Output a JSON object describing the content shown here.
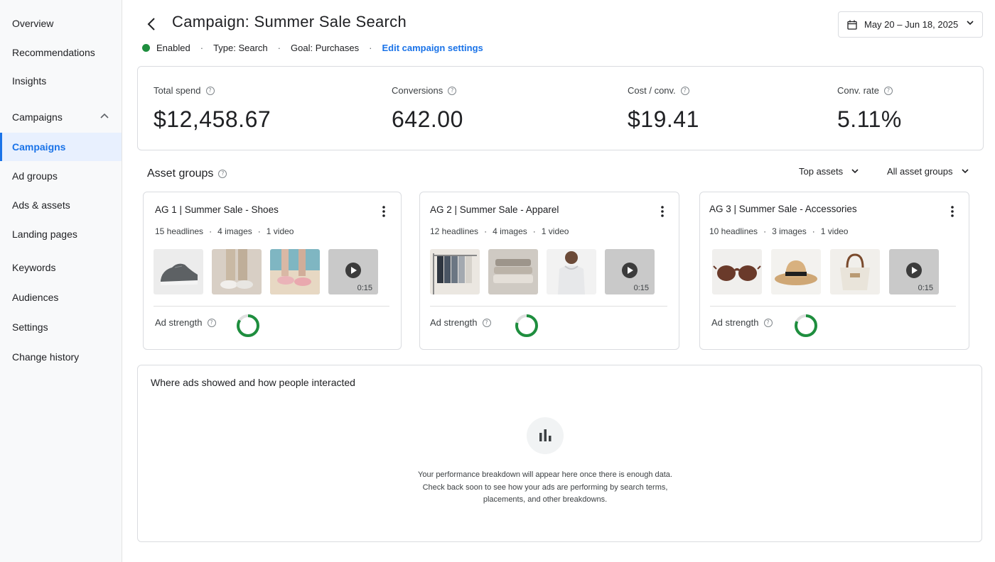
{
  "sidebar": {
    "items": [
      {
        "label": "Overview"
      },
      {
        "label": "Recommendations"
      },
      {
        "label": "Insights"
      },
      {
        "label": "Campaigns"
      },
      {
        "label": "Campaigns"
      },
      {
        "label": "Ad groups"
      },
      {
        "label": "Ads & assets"
      },
      {
        "label": "Landing pages"
      },
      {
        "label": "Keywords"
      },
      {
        "label": "Audiences"
      },
      {
        "label": "Settings"
      },
      {
        "label": "Change history"
      }
    ]
  },
  "header": {
    "title": "Campaign: Summer Sale Search",
    "status": "Enabled",
    "status_color": "#1e8e3e",
    "type": "Type: Search",
    "goal": "Goal: Purchases",
    "edit_link": "Edit campaign settings",
    "date_range": "May 20 – Jun 18, 2025"
  },
  "metrics": [
    {
      "label": "Total spend",
      "value": "$12,458.67"
    },
    {
      "label": "Conversions",
      "value": "642.00"
    },
    {
      "label": "Cost / conv.",
      "value": "$19.41"
    },
    {
      "label": "Conv. rate",
      "value": "5.11%"
    }
  ],
  "asset_groups": {
    "title": "Asset groups",
    "filter_top": "Top assets",
    "filter_all": "All asset groups",
    "cards": [
      {
        "name": "AG 1 | Summer Sale - Shoes",
        "headlines": "15 headlines",
        "images": "4 images",
        "videos": "1 video",
        "video_duration": "0:15",
        "strength_label": "Ad strength"
      },
      {
        "name": "AG 2 | Summer Sale - Apparel",
        "headlines": "12 headlines",
        "images": "4 images",
        "videos": "1 video",
        "video_duration": "0:15",
        "strength_label": "Ad strength"
      },
      {
        "name": "AG 3 | Summer Sale - Accessories",
        "headlines": "10 headlines",
        "images": "3 images",
        "videos": "1 video",
        "video_duration": "0:15",
        "strength_label": "Ad strength"
      }
    ]
  },
  "where": {
    "title": "Where ads showed and how people interacted",
    "message_line1": "Your performance breakdown will appear here once there is enough data.",
    "message_line2": "Check back soon to see how your ads are performing by search terms,",
    "message_line3": "placements, and other breakdowns."
  }
}
